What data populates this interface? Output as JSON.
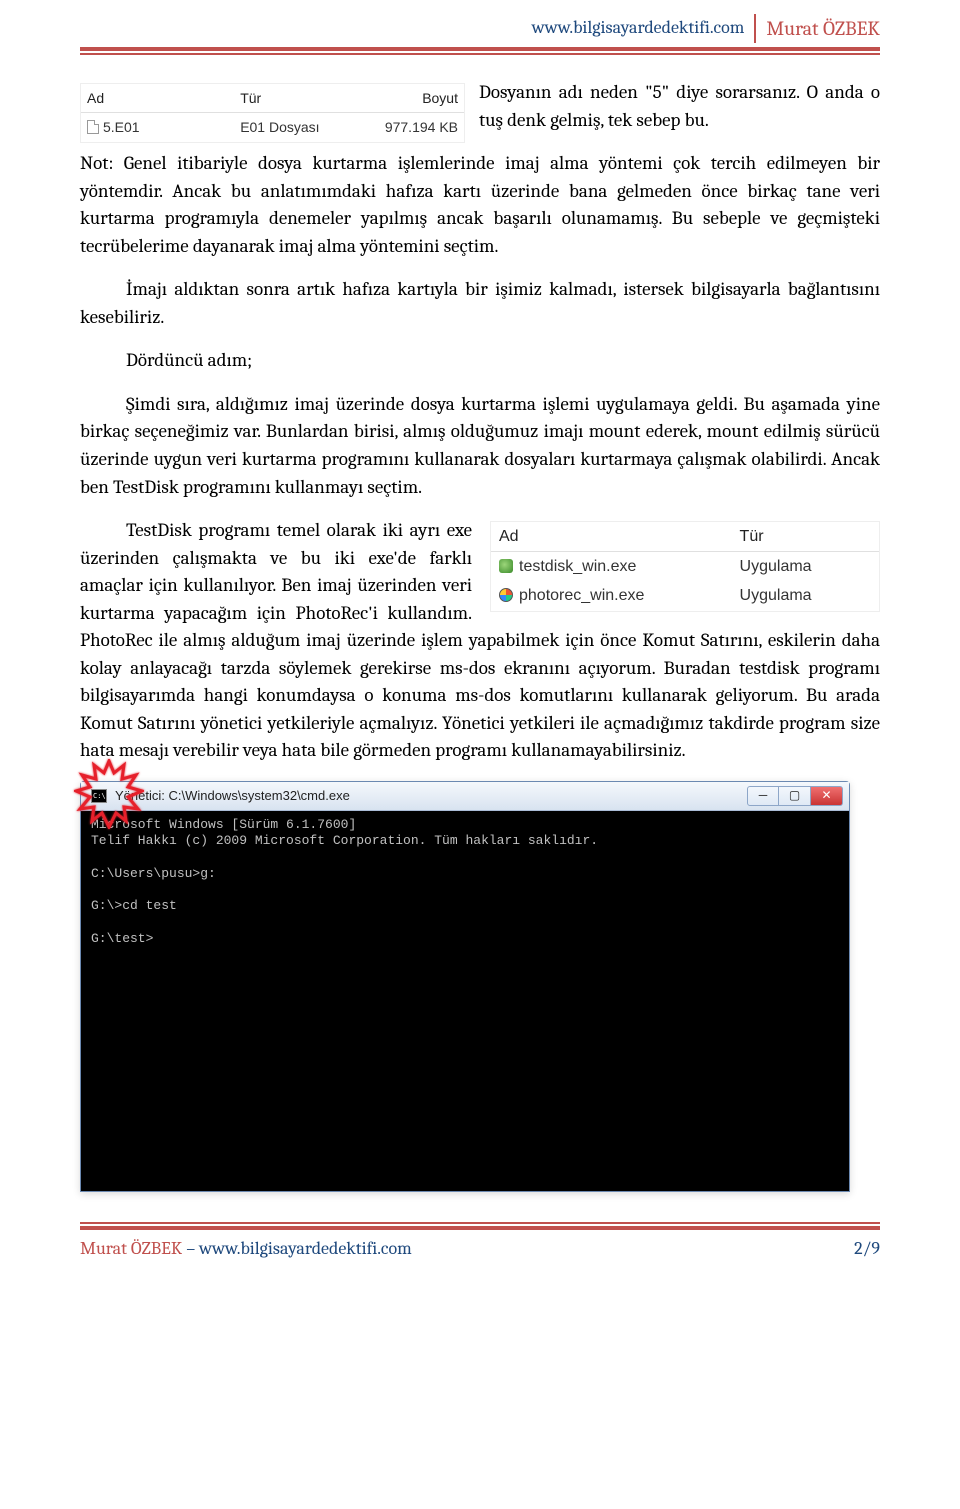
{
  "header": {
    "url": "www.bilgisayardedektifi.com",
    "author": "Murat ÖZBEK"
  },
  "file_listing_1": {
    "cols": {
      "ad": "Ad",
      "tur": "Tür",
      "boyut": "Boyut"
    },
    "row": {
      "name": "5.E01",
      "type": "E01 Dosyası",
      "size": "977.194 KB"
    }
  },
  "paragraphs": {
    "p1": "Dosyanın adı neden \"5\" diye sorarsanız. O anda o tuş denk gelmiş, tek sebep bu.",
    "p2": "Not: Genel itibariyle dosya kurtarma işlemlerinde imaj alma yöntemi çok tercih edilmeyen bir yöntemdir. Ancak bu anlatımımdaki hafıza kartı üzerinde bana gelmeden önce birkaç tane veri kurtarma programıyla denemeler yapılmış ancak başarılı olunamamış. Bu sebeple ve geçmişteki tecrübelerime dayanarak imaj alma yöntemini seçtim.",
    "p3": "İmajı aldıktan sonra artık hafıza kartıyla bir işimiz kalmadı, istersek bilgisayarla bağlantısını kesebiliriz.",
    "p4": "Dördüncü adım;",
    "p5": "Şimdi sıra, aldığımız imaj üzerinde dosya kurtarma işlemi uygulamaya geldi. Bu aşamada yine birkaç seçeneğimiz var. Bunlardan birisi, almış olduğumuz imajı mount ederek, mount edilmiş sürücü üzerinde uygun veri kurtarma programını kullanarak dosyaları kurtarmaya çalışmak olabilirdi. Ancak ben TestDisk programını kullanmayı seçtim.",
    "p6": "TestDisk programı temel olarak iki ayrı exe üzerinden çalışmakta ve bu iki exe'de farklı amaçlar için kullanılıyor. Ben imaj üzerinden veri kurtarma yapacağım için PhotoRec'i kullandım. PhotoRec ile almış alduğum imaj üzerinde işlem yapabilmek için önce Komut Satırını, eskilerin daha kolay anlayacağı tarzda söylemek gerekirse ms-dos ekranını açıyorum. Buradan testdisk programı bilgisayarımda hangi konumdaysa o konuma ms-dos komutlarını kullanarak geliyorum. Bu arada Komut Satırını yönetici yetkileriyle açmalıyız. Yönetici yetkileri ile açmadığımız takdirde program size hata mesajı verebilir veya hata bile görmeden programı kullanamayabilirsiniz."
  },
  "file_listing_2": {
    "cols": {
      "ad": "Ad",
      "tur": "Tür"
    },
    "rows": [
      {
        "name": "testdisk_win.exe",
        "type": "Uygulama"
      },
      {
        "name": "photorec_win.exe",
        "type": "Uygulama"
      }
    ]
  },
  "cmd": {
    "title": "Yönetici: C:\\Windows\\system32\\cmd.exe",
    "lines": "Microsoft Windows [Sürüm 6.1.7600]\nTelif Hakkı (c) 2009 Microsoft Corporation. Tüm hakları saklıdır.\n\nC:\\Users\\pusu>g:\n\nG:\\>cd test\n\nG:\\test>"
  },
  "footer": {
    "author": "Murat ÖZBEK",
    "sep": " – ",
    "url": "www.bilgisayardedektifi.com",
    "page": "2/9"
  }
}
